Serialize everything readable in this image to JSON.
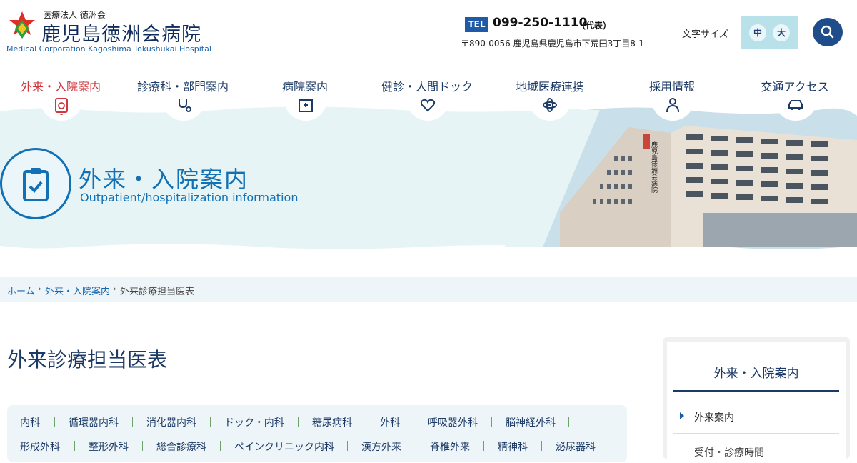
{
  "header": {
    "corp": "医療法人 徳洲会",
    "name": "鹿児島徳洲会病院",
    "name_en": "Medical Corporation Kagoshima Tokushukai Hospital",
    "tel_badge": "TEL",
    "tel": "099-250-1110",
    "tel_note": "（代表）",
    "address": "〒890-0056 鹿児島県鹿児島市下荒田3丁目8-1",
    "font_size_label": "文字サイズ",
    "font_mid": "中",
    "font_large": "大",
    "search_icon": "search-icon"
  },
  "nav": {
    "items": [
      {
        "label": "外来・入院案内",
        "icon": "clipboard-icon",
        "active": true
      },
      {
        "label": "診療科・部門案内",
        "icon": "stethoscope-icon"
      },
      {
        "label": "病院案内",
        "icon": "hospital-icon"
      },
      {
        "label": "健診・人間ドック",
        "icon": "heart-hand-icon"
      },
      {
        "label": "地域医療連携",
        "icon": "network-icon"
      },
      {
        "label": "採用情報",
        "icon": "person-icon"
      },
      {
        "label": "交通アクセス",
        "icon": "car-icon"
      }
    ]
  },
  "hero": {
    "title": "外来・入院案内",
    "subtitle": "Outpatient/hospitalization information",
    "building_sign": "鹿児島徳洲会病院"
  },
  "breadcrumb": {
    "home": "ホーム",
    "parent": "外来・入院案内",
    "current": "外来診療担当医表"
  },
  "main": {
    "title": "外来診療担当医表",
    "tabs_row1": [
      "内科",
      "循環器内科",
      "消化器内科",
      "ドック・内科",
      "糖尿病科",
      "外科",
      "呼吸器外科",
      "脳神経外科"
    ],
    "tabs_row2": [
      "形成外科",
      "整形外科",
      "総合診療科",
      "ペインクリニック内科",
      "漢方外来",
      "脊椎外来",
      "精神科",
      "泌尿器科"
    ]
  },
  "sidebar": {
    "title": "外来・入院案内",
    "links": [
      "外来案内",
      "受付・診療時間"
    ]
  },
  "colors": {
    "primary": "#1c3a66",
    "accent_blue": "#1270b3",
    "active_red": "#d2363e",
    "hero_bg": "#e6f4f6"
  }
}
